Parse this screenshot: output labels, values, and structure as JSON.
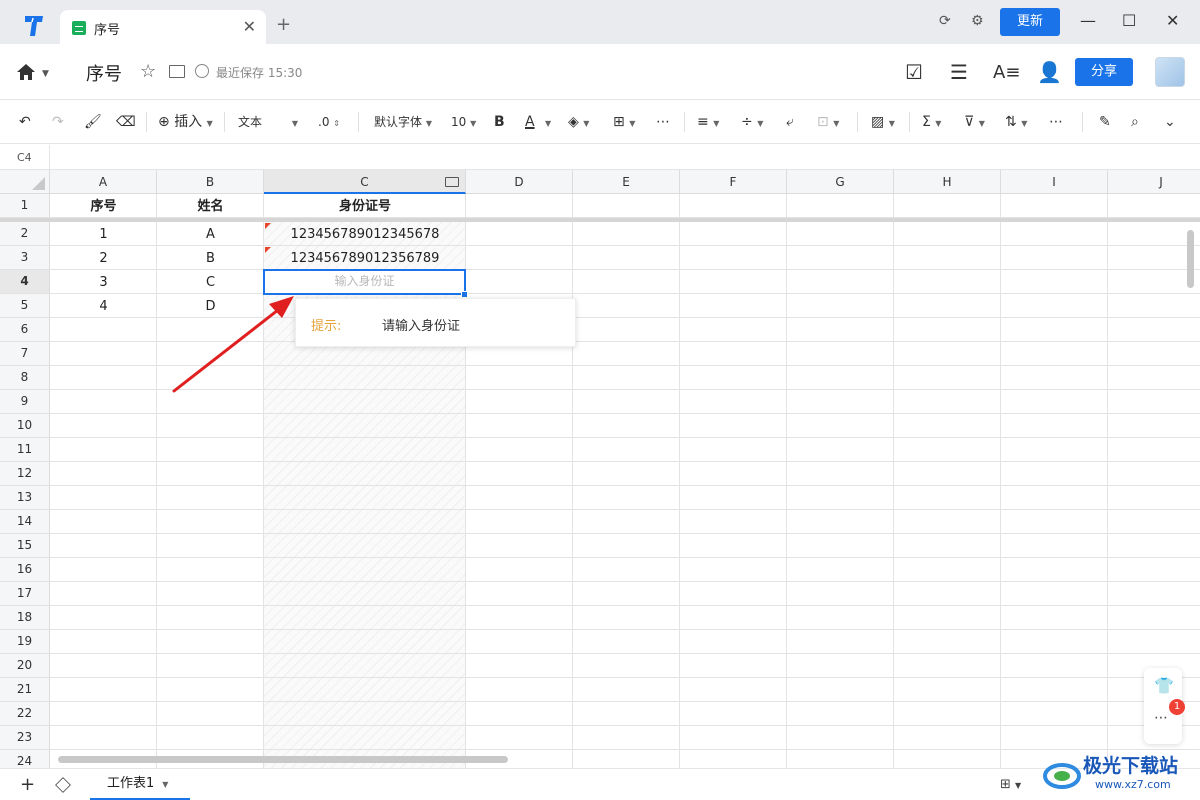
{
  "window": {
    "tab_title": "序号",
    "update_label": "更新"
  },
  "header": {
    "doc_title": "序号",
    "saved_text": "最近保存 15:30",
    "share_label": "分享"
  },
  "toolbar": {
    "insert_label": "插入",
    "format_label": "文本",
    "decimal_label": ".0",
    "font_label": "默认字体",
    "size_label": "10",
    "bold_label": "B",
    "color_label": "A"
  },
  "namebox": "C4",
  "columns": [
    "A",
    "B",
    "C",
    "D",
    "E",
    "F",
    "G",
    "H",
    "I",
    "J"
  ],
  "rows": [
    "1",
    "2",
    "3",
    "4",
    "5",
    "6",
    "7",
    "8",
    "9",
    "10",
    "11",
    "12",
    "13",
    "14",
    "15",
    "16",
    "17",
    "18",
    "19",
    "20",
    "21",
    "22",
    "23",
    "24"
  ],
  "table": {
    "headers": [
      "序号",
      "姓名",
      "身份证号"
    ],
    "rows": [
      [
        "1",
        "A",
        "123456789012345678"
      ],
      [
        "2",
        "B",
        "123456789012356789"
      ],
      [
        "3",
        "C",
        ""
      ],
      [
        "4",
        "D",
        ""
      ]
    ]
  },
  "active_cell": {
    "placeholder": "输入身份证"
  },
  "tooltip": {
    "label": "提示:",
    "text": "请输入身份证"
  },
  "badge_count": "1",
  "sheet_tab": "工作表1",
  "watermark": {
    "text": "极光下载站",
    "url": "www.xz7.com"
  },
  "colors": {
    "accent": "#1a73e8",
    "error_mark": "#e8452e",
    "tip_label": "#e6a23c",
    "arrow": "#e02020"
  }
}
